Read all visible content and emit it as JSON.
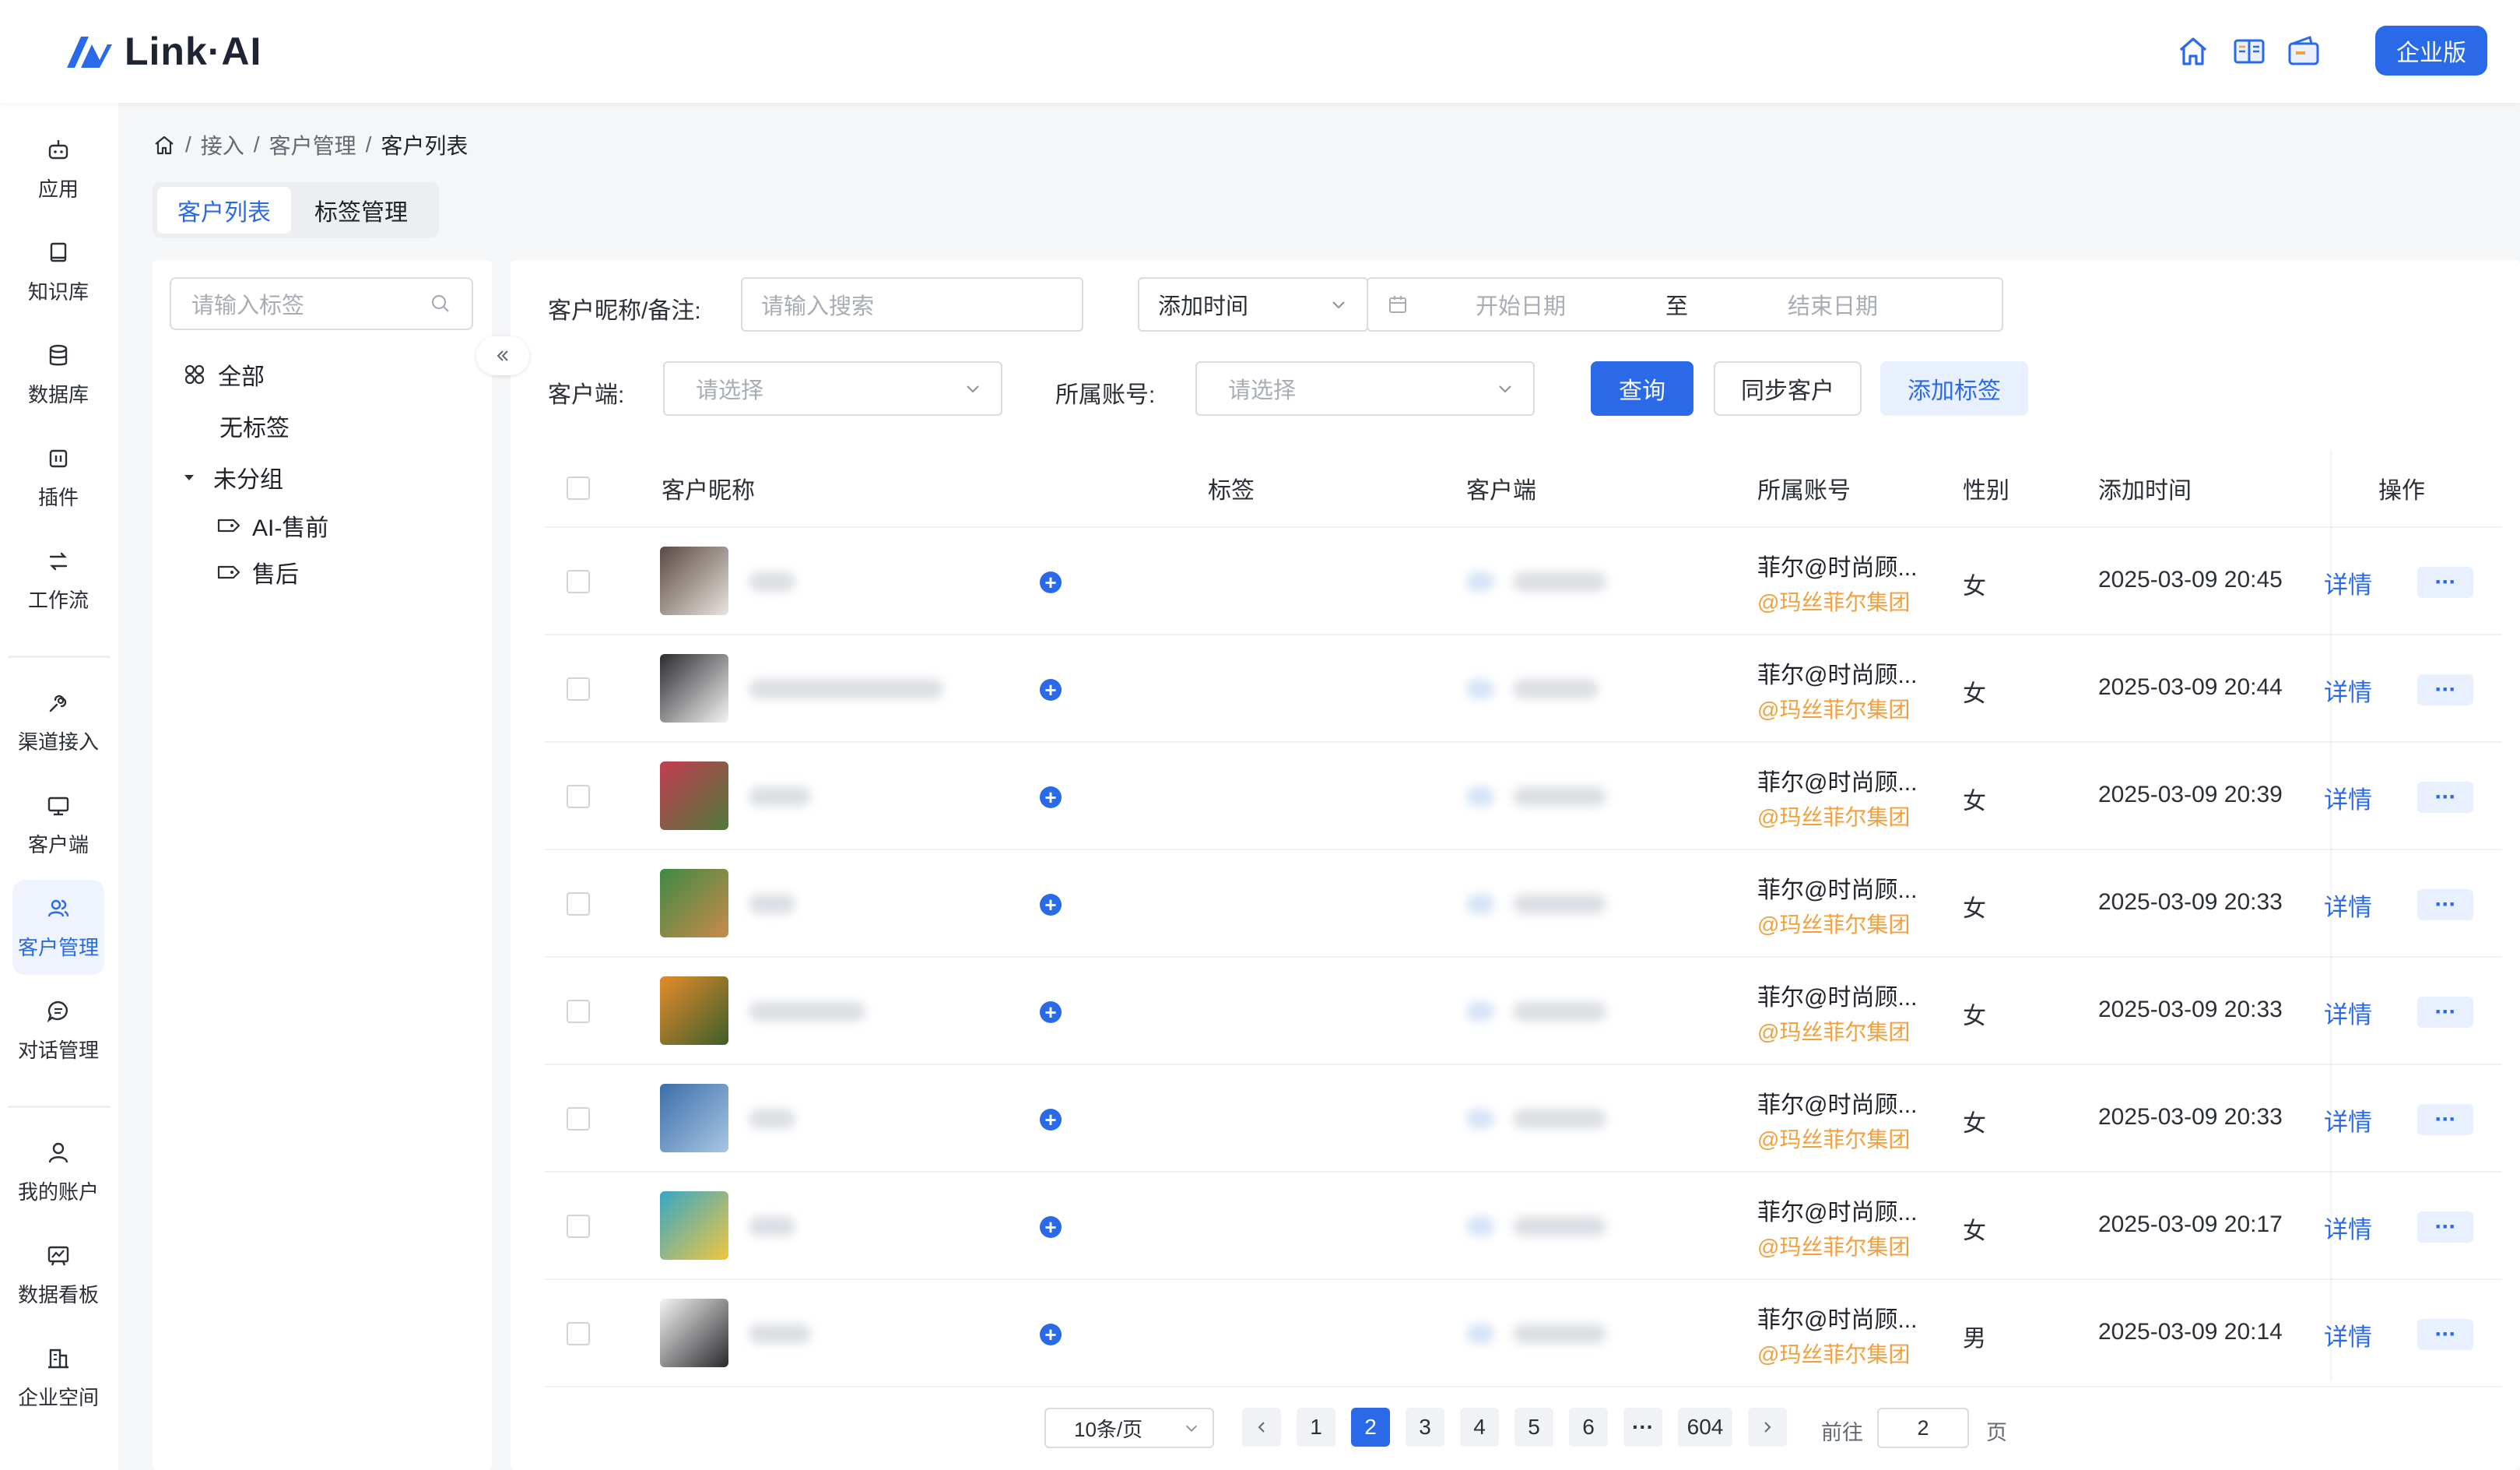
{
  "header": {
    "logo_text": "Link·AI",
    "icons": [
      "home-icon",
      "book-icon",
      "wallet-icon"
    ],
    "enterprise_label": "企业版"
  },
  "sidebar": {
    "items": [
      {
        "label": "应用",
        "icon": "robot-icon"
      },
      {
        "label": "知识库",
        "icon": "book-icon"
      },
      {
        "label": "数据库",
        "icon": "database-icon"
      },
      {
        "label": "插件",
        "icon": "plugin-icon"
      },
      {
        "label": "工作流",
        "icon": "workflow-icon"
      },
      {
        "label": "渠道接入",
        "icon": "link-icon"
      },
      {
        "label": "客户端",
        "icon": "monitor-icon"
      },
      {
        "label": "客户管理",
        "icon": "users-icon",
        "active": true
      },
      {
        "label": "对话管理",
        "icon": "chat-icon"
      },
      {
        "label": "我的账户",
        "icon": "user-icon"
      },
      {
        "label": "数据看板",
        "icon": "chart-board-icon"
      },
      {
        "label": "企业空间",
        "icon": "building-icon"
      }
    ]
  },
  "breadcrumb": {
    "sep": "/",
    "items": [
      "接入",
      "客户管理",
      "客户列表"
    ]
  },
  "tabs": [
    {
      "label": "客户列表",
      "active": true
    },
    {
      "label": "标签管理",
      "active": false
    }
  ],
  "tree": {
    "search_placeholder": "请输入标签",
    "all": "全部",
    "no_tag": "无标签",
    "ungrouped": "未分组",
    "children": [
      "AI-售前",
      "售后"
    ]
  },
  "filters": {
    "nickname_label": "客户昵称/备注:",
    "nickname_placeholder": "请输入搜索",
    "time_type": "添加时间",
    "start_placeholder": "开始日期",
    "range_sep": "至",
    "end_placeholder": "结束日期",
    "client_label": "客户端:",
    "client_placeholder": "请选择",
    "account_label": "所属账号:",
    "account_placeholder": "请选择",
    "query_btn": "查询",
    "sync_btn": "同步客户",
    "add_tag_btn": "添加标签"
  },
  "table": {
    "columns": {
      "nickname": "客户昵称",
      "tags": "标签",
      "client": "客户端",
      "account": "所属账号",
      "gender": "性别",
      "time": "添加时间",
      "action": "操作"
    },
    "detail_label": "详情",
    "more_label": "···",
    "rows": [
      {
        "account": "菲尔@时尚顾...",
        "org": "@玛丝菲尔集团",
        "gender": "女",
        "time": "2025-03-09 20:45",
        "avatar": [
          "#5a4a42",
          "#e9e4de"
        ]
      },
      {
        "account": "菲尔@时尚顾...",
        "org": "@玛丝菲尔集团",
        "gender": "女",
        "time": "2025-03-09 20:44",
        "avatar": [
          "#2c2c30",
          "#f4f4f4"
        ]
      },
      {
        "account": "菲尔@时尚顾...",
        "org": "@玛丝菲尔集团",
        "gender": "女",
        "time": "2025-03-09 20:39",
        "avatar": [
          "#c43b52",
          "#4f7a3a"
        ]
      },
      {
        "account": "菲尔@时尚顾...",
        "org": "@玛丝菲尔集团",
        "gender": "女",
        "time": "2025-03-09 20:33",
        "avatar": [
          "#3f8a43",
          "#c98a4a"
        ]
      },
      {
        "account": "菲尔@时尚顾...",
        "org": "@玛丝菲尔集团",
        "gender": "女",
        "time": "2025-03-09 20:33",
        "avatar": [
          "#e38b2a",
          "#3d5e2a"
        ]
      },
      {
        "account": "菲尔@时尚顾...",
        "org": "@玛丝菲尔集团",
        "gender": "女",
        "time": "2025-03-09 20:33",
        "avatar": [
          "#3b6fa8",
          "#a9c6e4"
        ]
      },
      {
        "account": "菲尔@时尚顾...",
        "org": "@玛丝菲尔集团",
        "gender": "女",
        "time": "2025-03-09 20:17",
        "avatar": [
          "#37a7c7",
          "#f0c640"
        ]
      },
      {
        "account": "菲尔@时尚顾...",
        "org": "@玛丝菲尔集团",
        "gender": "男",
        "time": "2025-03-09 20:14",
        "avatar": [
          "#f4f4f4",
          "#2a2a2e"
        ]
      }
    ]
  },
  "pagination": {
    "page_size": "10条/页",
    "pages": [
      "1",
      "2",
      "3",
      "4",
      "5",
      "6"
    ],
    "current": "2",
    "ellipsis": "···",
    "last": "604",
    "goto_label": "前往",
    "goto_value": "2",
    "page_suffix": "页"
  },
  "colors": {
    "accent": "#2a6ae9",
    "org": "#f2a03d"
  }
}
